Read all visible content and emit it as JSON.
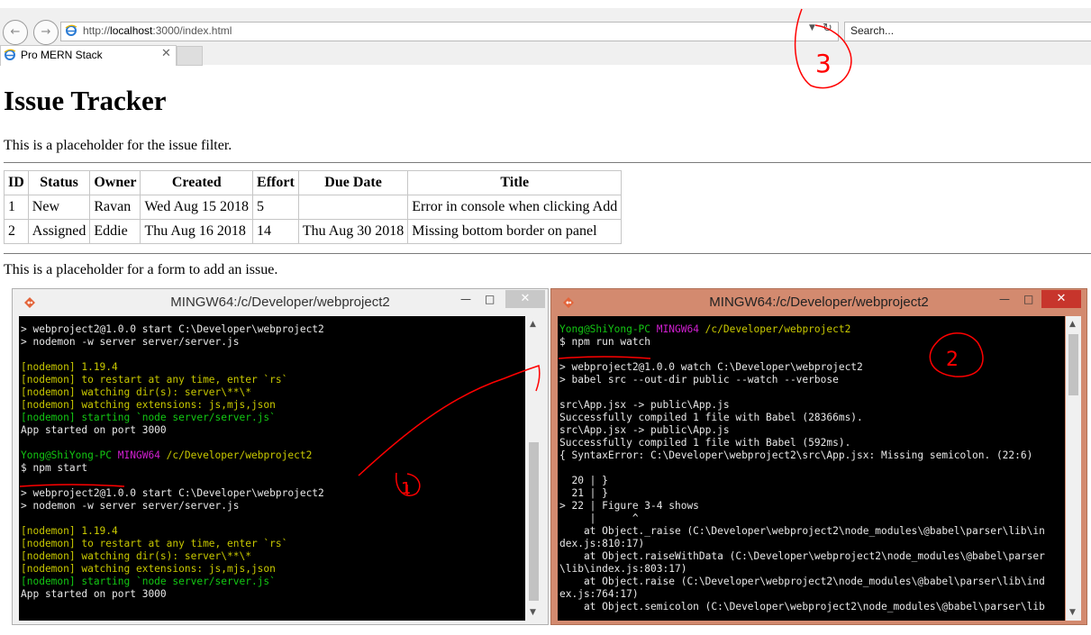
{
  "browser": {
    "url_prefix": "http://",
    "url_host": "localhost",
    "url_rest": ":3000/index.html",
    "search_placeholder": "Search...",
    "tab_title": "Pro MERN Stack",
    "back_icon": "back-arrow-icon",
    "forward_icon": "forward-arrow-icon",
    "refresh_icon": "refresh-icon"
  },
  "page": {
    "heading": "Issue Tracker",
    "filter_placeholder": "This is a placeholder for the issue filter.",
    "add_placeholder": "This is a placeholder for a form to add an issue.",
    "table": {
      "headers": [
        "ID",
        "Status",
        "Owner",
        "Created",
        "Effort",
        "Due Date",
        "Title"
      ],
      "rows": [
        [
          "1",
          "New",
          "Ravan",
          "Wed Aug 15 2018",
          "5",
          "",
          "Error in console when clicking Add"
        ],
        [
          "2",
          "Assigned",
          "Eddie",
          "Thu Aug 16 2018",
          "14",
          "Thu Aug 30 2018",
          "Missing bottom border on panel"
        ]
      ]
    }
  },
  "terminal_left": {
    "title": "MINGW64:/c/Developer/webproject2",
    "lines": [
      {
        "t": "> webproject2@1.0.0 start C:\\Developer\\webproject2",
        "c": "w"
      },
      {
        "t": "> nodemon -w server server/server.js",
        "c": "w"
      },
      {
        "t": "",
        "c": "w"
      },
      {
        "t": "[nodemon] 1.19.4",
        "c": "y"
      },
      {
        "t": "[nodemon] to restart at any time, enter `rs`",
        "c": "y"
      },
      {
        "t": "[nodemon] watching dir(s): server\\**\\*",
        "c": "y"
      },
      {
        "t": "[nodemon] watching extensions: js,mjs,json",
        "c": "y"
      },
      {
        "t": "[nodemon] starting `node server/server.js`",
        "c": "g"
      },
      {
        "t": "App started on port 3000",
        "c": "w"
      },
      {
        "t": "",
        "c": "w"
      },
      {
        "prompt": true,
        "user": "Yong@ShiYong-PC",
        "sys": "MINGW64",
        "path": "/c/Developer/webproject2"
      },
      {
        "t": "$ npm start",
        "c": "w"
      },
      {
        "t": "",
        "c": "w"
      },
      {
        "t": "> webproject2@1.0.0 start C:\\Developer\\webproject2",
        "c": "w"
      },
      {
        "t": "> nodemon -w server server/server.js",
        "c": "w"
      },
      {
        "t": "",
        "c": "w"
      },
      {
        "t": "[nodemon] 1.19.4",
        "c": "y"
      },
      {
        "t": "[nodemon] to restart at any time, enter `rs`",
        "c": "y"
      },
      {
        "t": "[nodemon] watching dir(s): server\\**\\*",
        "c": "y"
      },
      {
        "t": "[nodemon] watching extensions: js,mjs,json",
        "c": "y"
      },
      {
        "t": "[nodemon] starting `node server/server.js`",
        "c": "g"
      },
      {
        "t": "App started on port 3000",
        "c": "w"
      }
    ]
  },
  "terminal_right": {
    "title": "MINGW64:/c/Developer/webproject2",
    "lines": [
      {
        "prompt": true,
        "user": "Yong@ShiYong-PC",
        "sys": "MINGW64",
        "path": "/c/Developer/webproject2"
      },
      {
        "t": "$ npm run watch",
        "c": "w"
      },
      {
        "t": "",
        "c": "w"
      },
      {
        "t": "> webproject2@1.0.0 watch C:\\Developer\\webproject2",
        "c": "w"
      },
      {
        "t": "> babel src --out-dir public --watch --verbose",
        "c": "w"
      },
      {
        "t": "",
        "c": "w"
      },
      {
        "t": "src\\App.jsx -> public\\App.js",
        "c": "w"
      },
      {
        "t": "Successfully compiled 1 file with Babel (28366ms).",
        "c": "w"
      },
      {
        "t": "src\\App.jsx -> public\\App.js",
        "c": "w"
      },
      {
        "t": "Successfully compiled 1 file with Babel (592ms).",
        "c": "w"
      },
      {
        "t": "{ SyntaxError: C:\\Developer\\webproject2\\src\\App.jsx: Missing semicolon. (22:6)",
        "c": "w"
      },
      {
        "t": "",
        "c": "w"
      },
      {
        "t": "  20 | }",
        "c": "w"
      },
      {
        "t": "  21 | }",
        "c": "w"
      },
      {
        "t": "> 22 | Figure 3-4 shows",
        "c": "w"
      },
      {
        "t": "     |      ^",
        "c": "w"
      },
      {
        "t": "    at Object._raise (C:\\Developer\\webproject2\\node_modules\\@babel\\parser\\lib\\in",
        "c": "w"
      },
      {
        "t": "dex.js:810:17)",
        "c": "w"
      },
      {
        "t": "    at Object.raiseWithData (C:\\Developer\\webproject2\\node_modules\\@babel\\parser",
        "c": "w"
      },
      {
        "t": "\\lib\\index.js:803:17)",
        "c": "w"
      },
      {
        "t": "    at Object.raise (C:\\Developer\\webproject2\\node_modules\\@babel\\parser\\lib\\ind",
        "c": "w"
      },
      {
        "t": "ex.js:764:17)",
        "c": "w"
      },
      {
        "t": "    at Object.semicolon (C:\\Developer\\webproject2\\node_modules\\@babel\\parser\\lib",
        "c": "w"
      }
    ]
  },
  "annotations": [
    "1",
    "2",
    "3"
  ],
  "colors": {
    "active_window": "#d38a6f",
    "inactive_window": "#f0f0f0",
    "close_red": "#c7352c",
    "annotation": "#ff0000"
  }
}
